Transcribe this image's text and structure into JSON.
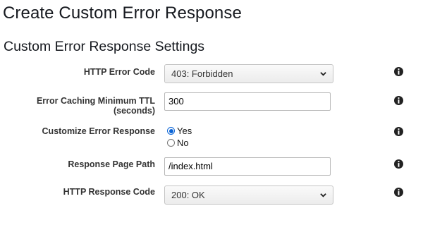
{
  "page": {
    "title": "Create Custom Error Response",
    "section_title": "Custom Error Response Settings"
  },
  "form": {
    "http_error_code": {
      "label": "HTTP Error Code",
      "selected": "403: Forbidden"
    },
    "error_caching_ttl": {
      "label_line1": "Error Caching Minimum TTL",
      "label_line2": "(seconds)",
      "value": "300"
    },
    "customize_error_response": {
      "label": "Customize Error Response",
      "option_yes": "Yes",
      "option_no": "No",
      "selected": "Yes"
    },
    "response_page_path": {
      "label": "Response Page Path",
      "value": "/index.html"
    },
    "http_response_code": {
      "label": "HTTP Response Code",
      "selected": "200: OK"
    }
  },
  "icons": {
    "info": "info-icon",
    "dropdown": "chevron-down-icon"
  },
  "colors": {
    "radio_accent": "#0a64d6"
  }
}
